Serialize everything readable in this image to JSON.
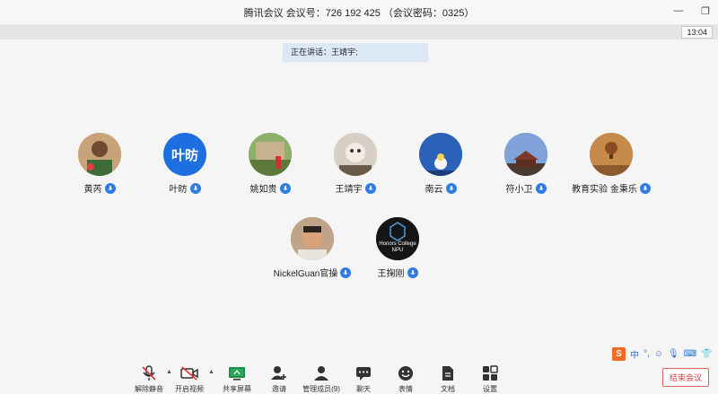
{
  "window": {
    "title": "腾讯会议  会议号：726 192 425  （会议密码：0325）",
    "minimize_glyph": "—",
    "restore_glyph": "❐",
    "clock": "13:04"
  },
  "speaking": {
    "text": "正在讲话：王靖宇;"
  },
  "participants": [
    {
      "name": "黄芮",
      "avatar_icon": "photo-avatar",
      "avatar_color": "#b88a60"
    },
    {
      "name": "叶昉",
      "avatar_icon": "text-avatar",
      "avatar_text": "叶昉",
      "avatar_color": "#1d6fe0"
    },
    {
      "name": "姚如贵",
      "avatar_icon": "photo-avatar",
      "avatar_color": "#6d8b4a"
    },
    {
      "name": "王靖宇",
      "avatar_icon": "photo-avatar",
      "avatar_color": "#a89a8a"
    },
    {
      "name": "南云",
      "avatar_icon": "photo-avatar",
      "avatar_color": "#2a5aa8"
    },
    {
      "name": "符小卫",
      "avatar_icon": "photo-avatar",
      "avatar_color": "#5b7db6"
    },
    {
      "name": "教育实验 金秉乐",
      "avatar_icon": "photo-avatar",
      "avatar_color": "#b2793a"
    },
    {
      "name": "NickelGuan官操",
      "avatar_icon": "photo-avatar",
      "avatar_color": "#a9856a"
    },
    {
      "name": "王掬刚",
      "avatar_icon": "logo-avatar",
      "avatar_color": "#151515",
      "avatar_text": "Honors College NPU"
    }
  ],
  "ime": {
    "logo": "S",
    "items": [
      "中",
      "°,",
      "☺",
      "🎙",
      "⌨",
      "👕"
    ]
  },
  "toolbar": {
    "items": [
      {
        "label": "解除静音",
        "icon": "mic-muted-icon"
      },
      {
        "label": "开启视频",
        "icon": "video-off-icon"
      },
      {
        "label": "共享屏幕",
        "icon": "share-screen-icon"
      },
      {
        "label": "邀请",
        "icon": "invite-icon"
      },
      {
        "label": "管理成员(9)",
        "icon": "members-icon"
      },
      {
        "label": "聊天",
        "icon": "chat-icon"
      },
      {
        "label": "表情",
        "icon": "emoji-icon"
      },
      {
        "label": "文档",
        "icon": "document-icon"
      },
      {
        "label": "设置",
        "icon": "settings-icon"
      }
    ],
    "end_label": "结束会议",
    "end_color": "#d9443d"
  }
}
